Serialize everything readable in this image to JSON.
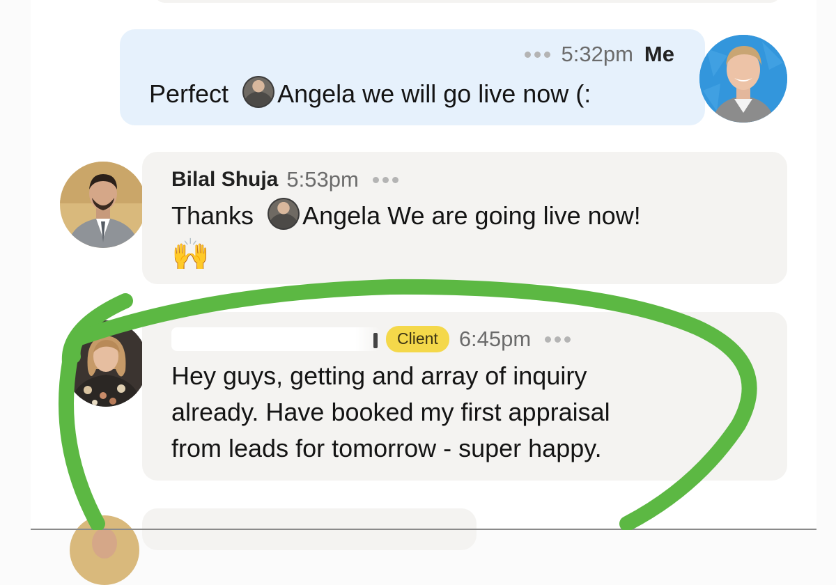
{
  "messages": [
    {
      "sender": "Me",
      "time": "5:32pm",
      "text_before": "Perfect ",
      "mention": "Angela",
      "text_after": " we will go live now (:"
    },
    {
      "sender": "Bilal Shuja",
      "time": "5:53pm",
      "text_before": "Thanks ",
      "mention": "Angela",
      "text_after": " We are going live now!",
      "emoji": "🙌"
    },
    {
      "badge": "Client",
      "time": "6:45pm",
      "lines": [
        "Hey guys, getting and array of inquiry",
        "already. Have booked my first appraisal",
        "from leads for tomorrow - super happy."
      ]
    }
  ],
  "colors": {
    "my_bubble": "#e6f1fc",
    "other_bubble": "#f4f3f1",
    "client_badge": "#f4d84a",
    "annotation_circle": "#5cb843"
  },
  "icons": {
    "more_options": "three-dots-icon",
    "annotation": "green-hand-drawn-circle"
  }
}
